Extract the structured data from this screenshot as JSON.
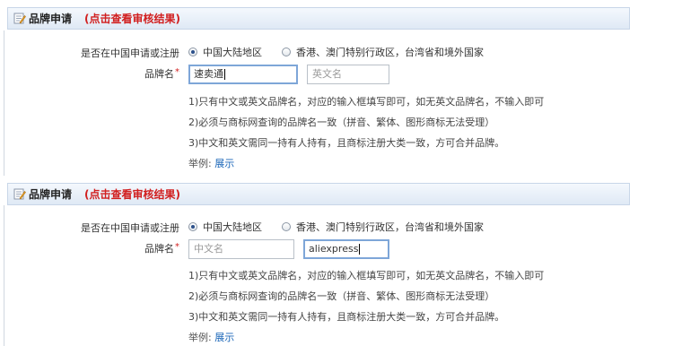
{
  "forms": [
    {
      "header": {
        "title": "品牌申请",
        "link": "(点击查看审核结果)"
      },
      "region": {
        "label": "是否在中国申请或注册",
        "options": [
          {
            "label": "中国大陆地区",
            "checked": true
          },
          {
            "label": "香港、澳门特别行政区，台湾省和境外国家",
            "checked": false
          }
        ]
      },
      "brand": {
        "label": "品牌名",
        "required_mark": "*",
        "chinese": {
          "value": "速卖通",
          "placeholder": "中文名"
        },
        "english": {
          "value": "",
          "placeholder": "英文名"
        }
      },
      "notes": [
        "1)只有中文或英文品牌名，对应的输入框填写即可，如无英文品牌名，不输入即可",
        "2)必须与商标网查询的品牌名一致（拼音、繁体、图形商标无法受理）",
        "3)中文和英文需同一持有人持有，且商标注册大类一致，方可合并品牌。"
      ],
      "example": {
        "label": "举例:",
        "link": "展示"
      }
    },
    {
      "header": {
        "title": "品牌申请",
        "link": "(点击查看审核结果)"
      },
      "region": {
        "label": "是否在中国申请或注册",
        "options": [
          {
            "label": "中国大陆地区",
            "checked": true
          },
          {
            "label": "香港、澳门特别行政区，台湾省和境外国家",
            "checked": false
          }
        ]
      },
      "brand": {
        "label": "品牌名",
        "required_mark": "*",
        "chinese": {
          "value": "",
          "placeholder": "中文名"
        },
        "english": {
          "value": "aliexpress",
          "placeholder": "英文名"
        }
      },
      "notes": [
        "1)只有中文或英文品牌名，对应的输入框填写即可，如无英文品牌名，不输入即可",
        "2)必须与商标网查询的品牌名一致（拼音、繁体、图形商标无法受理）",
        "3)中文和英文需同一持有人持有，且商标注册大类一致，方可合并品牌。"
      ],
      "example": {
        "label": "举例:",
        "link": "展示"
      }
    }
  ]
}
